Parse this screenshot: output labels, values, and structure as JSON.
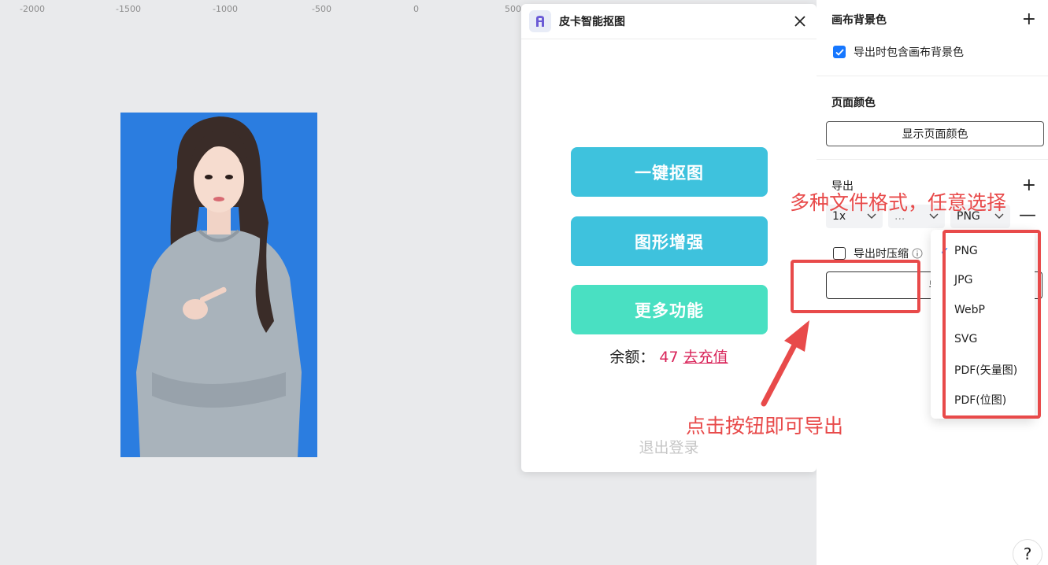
{
  "ruler": {
    "ticks": [
      "-2000",
      "-1500",
      "-1000",
      "-500",
      "0",
      "500"
    ]
  },
  "plugin": {
    "title": "皮卡智能抠图",
    "buttons": [
      "一键抠图",
      "图形增强",
      "更多功能"
    ],
    "balance_label": "余额：",
    "balance_value": "47",
    "recharge_link": "去充值",
    "logout": "退出登录"
  },
  "right_panel": {
    "canvas_bg_title": "画布背景色",
    "include_bg_label": "导出时包含画布背景色",
    "page_color_title": "页面颜色",
    "show_page_color": "显示页面颜色",
    "export_title": "导出",
    "scale": "1x",
    "suffix": "...",
    "format": "PNG",
    "compress_label": "导出时压缩",
    "export_button_partial": "导",
    "help": "?"
  },
  "dropdown": {
    "options": [
      "PNG",
      "JPG",
      "WebP",
      "SVG",
      "PDF(矢量图)",
      "PDF(位图)"
    ],
    "selected_index": 0
  },
  "annotations": {
    "formats_note": "多种文件格式，任意选择",
    "export_note": "点击按钮即可导出",
    "color": "#e84a4a"
  },
  "colors": {
    "canvas_bg": "#e9eaec",
    "photo_bg": "#2b7de0",
    "button_primary": "#3ec2dd",
    "button_more": "#49e0c2",
    "accent_pink": "#d9265b",
    "checkbox_blue": "#1677ff"
  }
}
